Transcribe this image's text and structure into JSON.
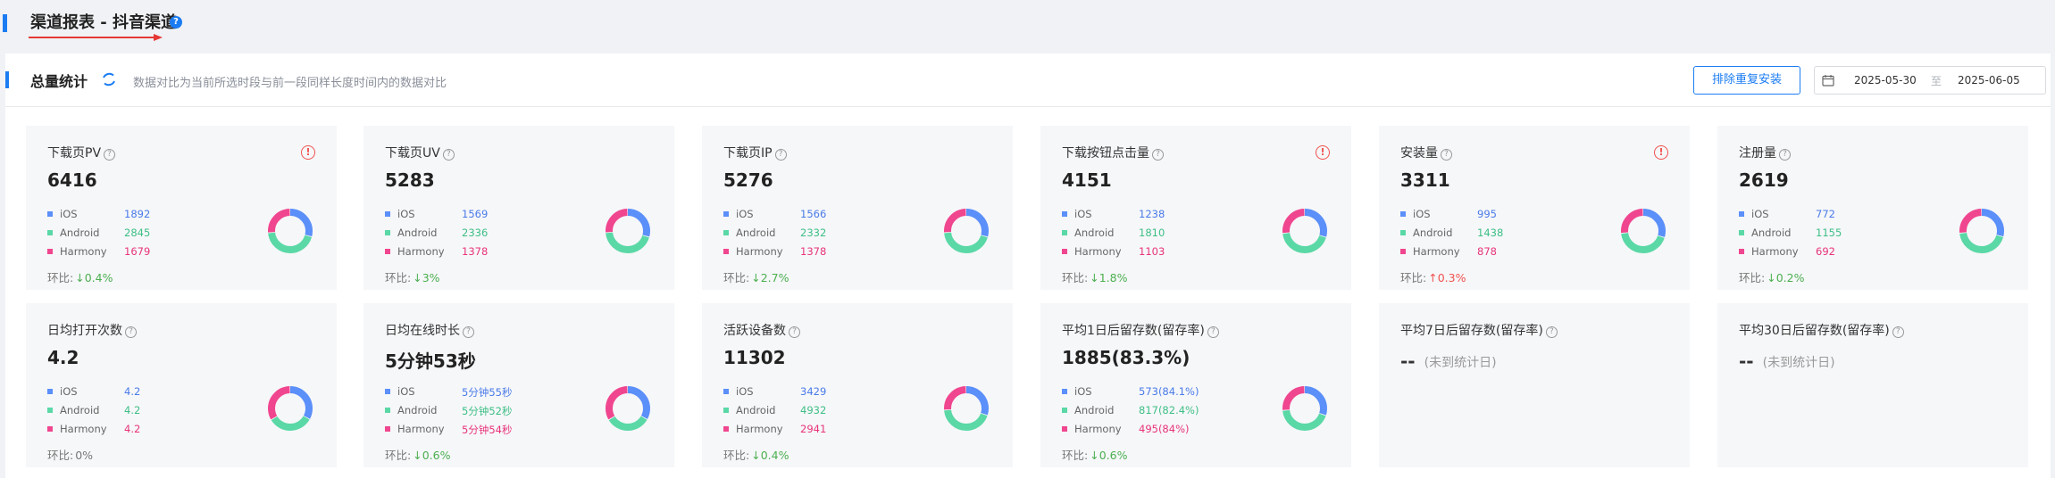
{
  "header": {
    "title": "渠道报表 - 抖音渠道",
    "info_icon": "question-circle-icon"
  },
  "summary": {
    "title": "总量统计",
    "description": "数据对比为当前所选时段与前一段同样长度时间内的数据对比",
    "dedupe_button": "排除重复安装",
    "date_start": "2025-05-30",
    "date_sep": "至",
    "date_end": "2025-06-05"
  },
  "colors": {
    "ios": "#5b8ff9",
    "android": "#5ad8a6",
    "harmony": "#f0468f",
    "accent": "#1b7cf2",
    "warn": "#f0524e",
    "down": "#4caf50"
  },
  "labels": {
    "ios": "iOS",
    "android": "Android",
    "harmony": "Harmony",
    "trend": "环比:",
    "nodata": "(未到统计日)",
    "dash": "--"
  },
  "metrics": [
    {
      "name": "下载页PV",
      "value": "6416",
      "warn": true,
      "ios": "1892",
      "android": "2845",
      "harmony": "1679",
      "trend": "0.4%",
      "dir": "down"
    },
    {
      "name": "下载页UV",
      "value": "5283",
      "warn": false,
      "ios": "1569",
      "android": "2336",
      "harmony": "1378",
      "trend": "3%",
      "dir": "down"
    },
    {
      "name": "下载页IP",
      "value": "5276",
      "warn": false,
      "ios": "1566",
      "android": "2332",
      "harmony": "1378",
      "trend": "2.7%",
      "dir": "down"
    },
    {
      "name": "下载按钮点击量",
      "value": "4151",
      "warn": true,
      "ios": "1238",
      "android": "1810",
      "harmony": "1103",
      "trend": "1.8%",
      "dir": "down"
    },
    {
      "name": "安装量",
      "value": "3311",
      "warn": true,
      "ios": "995",
      "android": "1438",
      "harmony": "878",
      "trend": "0.3%",
      "dir": "up"
    },
    {
      "name": "注册量",
      "value": "2619",
      "warn": false,
      "ios": "772",
      "android": "1155",
      "harmony": "692",
      "trend": "0.2%",
      "dir": "down"
    },
    {
      "name": "日均打开次数",
      "value": "4.2",
      "warn": false,
      "ios": "4.2",
      "android": "4.2",
      "harmony": "4.2",
      "trend": "0%",
      "dir": "flat"
    },
    {
      "name": "日均在线时长",
      "value": "5分钟53秒",
      "warn": false,
      "ios": "5分钟55秒",
      "android": "5分钟52秒",
      "harmony": "5分钟54秒",
      "trend": "0.6%",
      "dir": "down"
    },
    {
      "name": "活跃设备数",
      "value": "11302",
      "warn": false,
      "ios": "3429",
      "android": "4932",
      "harmony": "2941",
      "trend": "0.4%",
      "dir": "down"
    },
    {
      "name": "平均1日后留存数(留存率)",
      "value": "1885(83.3%)",
      "warn": false,
      "ios": "573(84.1%)",
      "android": "817(82.4%)",
      "harmony": "495(84%)",
      "trend": "0.6%",
      "dir": "down"
    },
    {
      "name": "平均7日后留存数(留存率)",
      "value": "",
      "nodata": true
    },
    {
      "name": "平均30日后留存数(留存率)",
      "value": "",
      "nodata": true
    }
  ],
  "donut": [
    {
      "ios": 1892,
      "android": 2845,
      "harmony": 1679
    },
    {
      "ios": 1569,
      "android": 2336,
      "harmony": 1378
    },
    {
      "ios": 1566,
      "android": 2332,
      "harmony": 1378
    },
    {
      "ios": 1238,
      "android": 1810,
      "harmony": 1103
    },
    {
      "ios": 995,
      "android": 1438,
      "harmony": 878
    },
    {
      "ios": 772,
      "android": 1155,
      "harmony": 692
    },
    {
      "ios": 4.2,
      "android": 4.2,
      "harmony": 4.2
    },
    {
      "ios": 355,
      "android": 352,
      "harmony": 354
    },
    {
      "ios": 3429,
      "android": 4932,
      "harmony": 2941
    },
    {
      "ios": 573,
      "android": 817,
      "harmony": 495
    }
  ]
}
